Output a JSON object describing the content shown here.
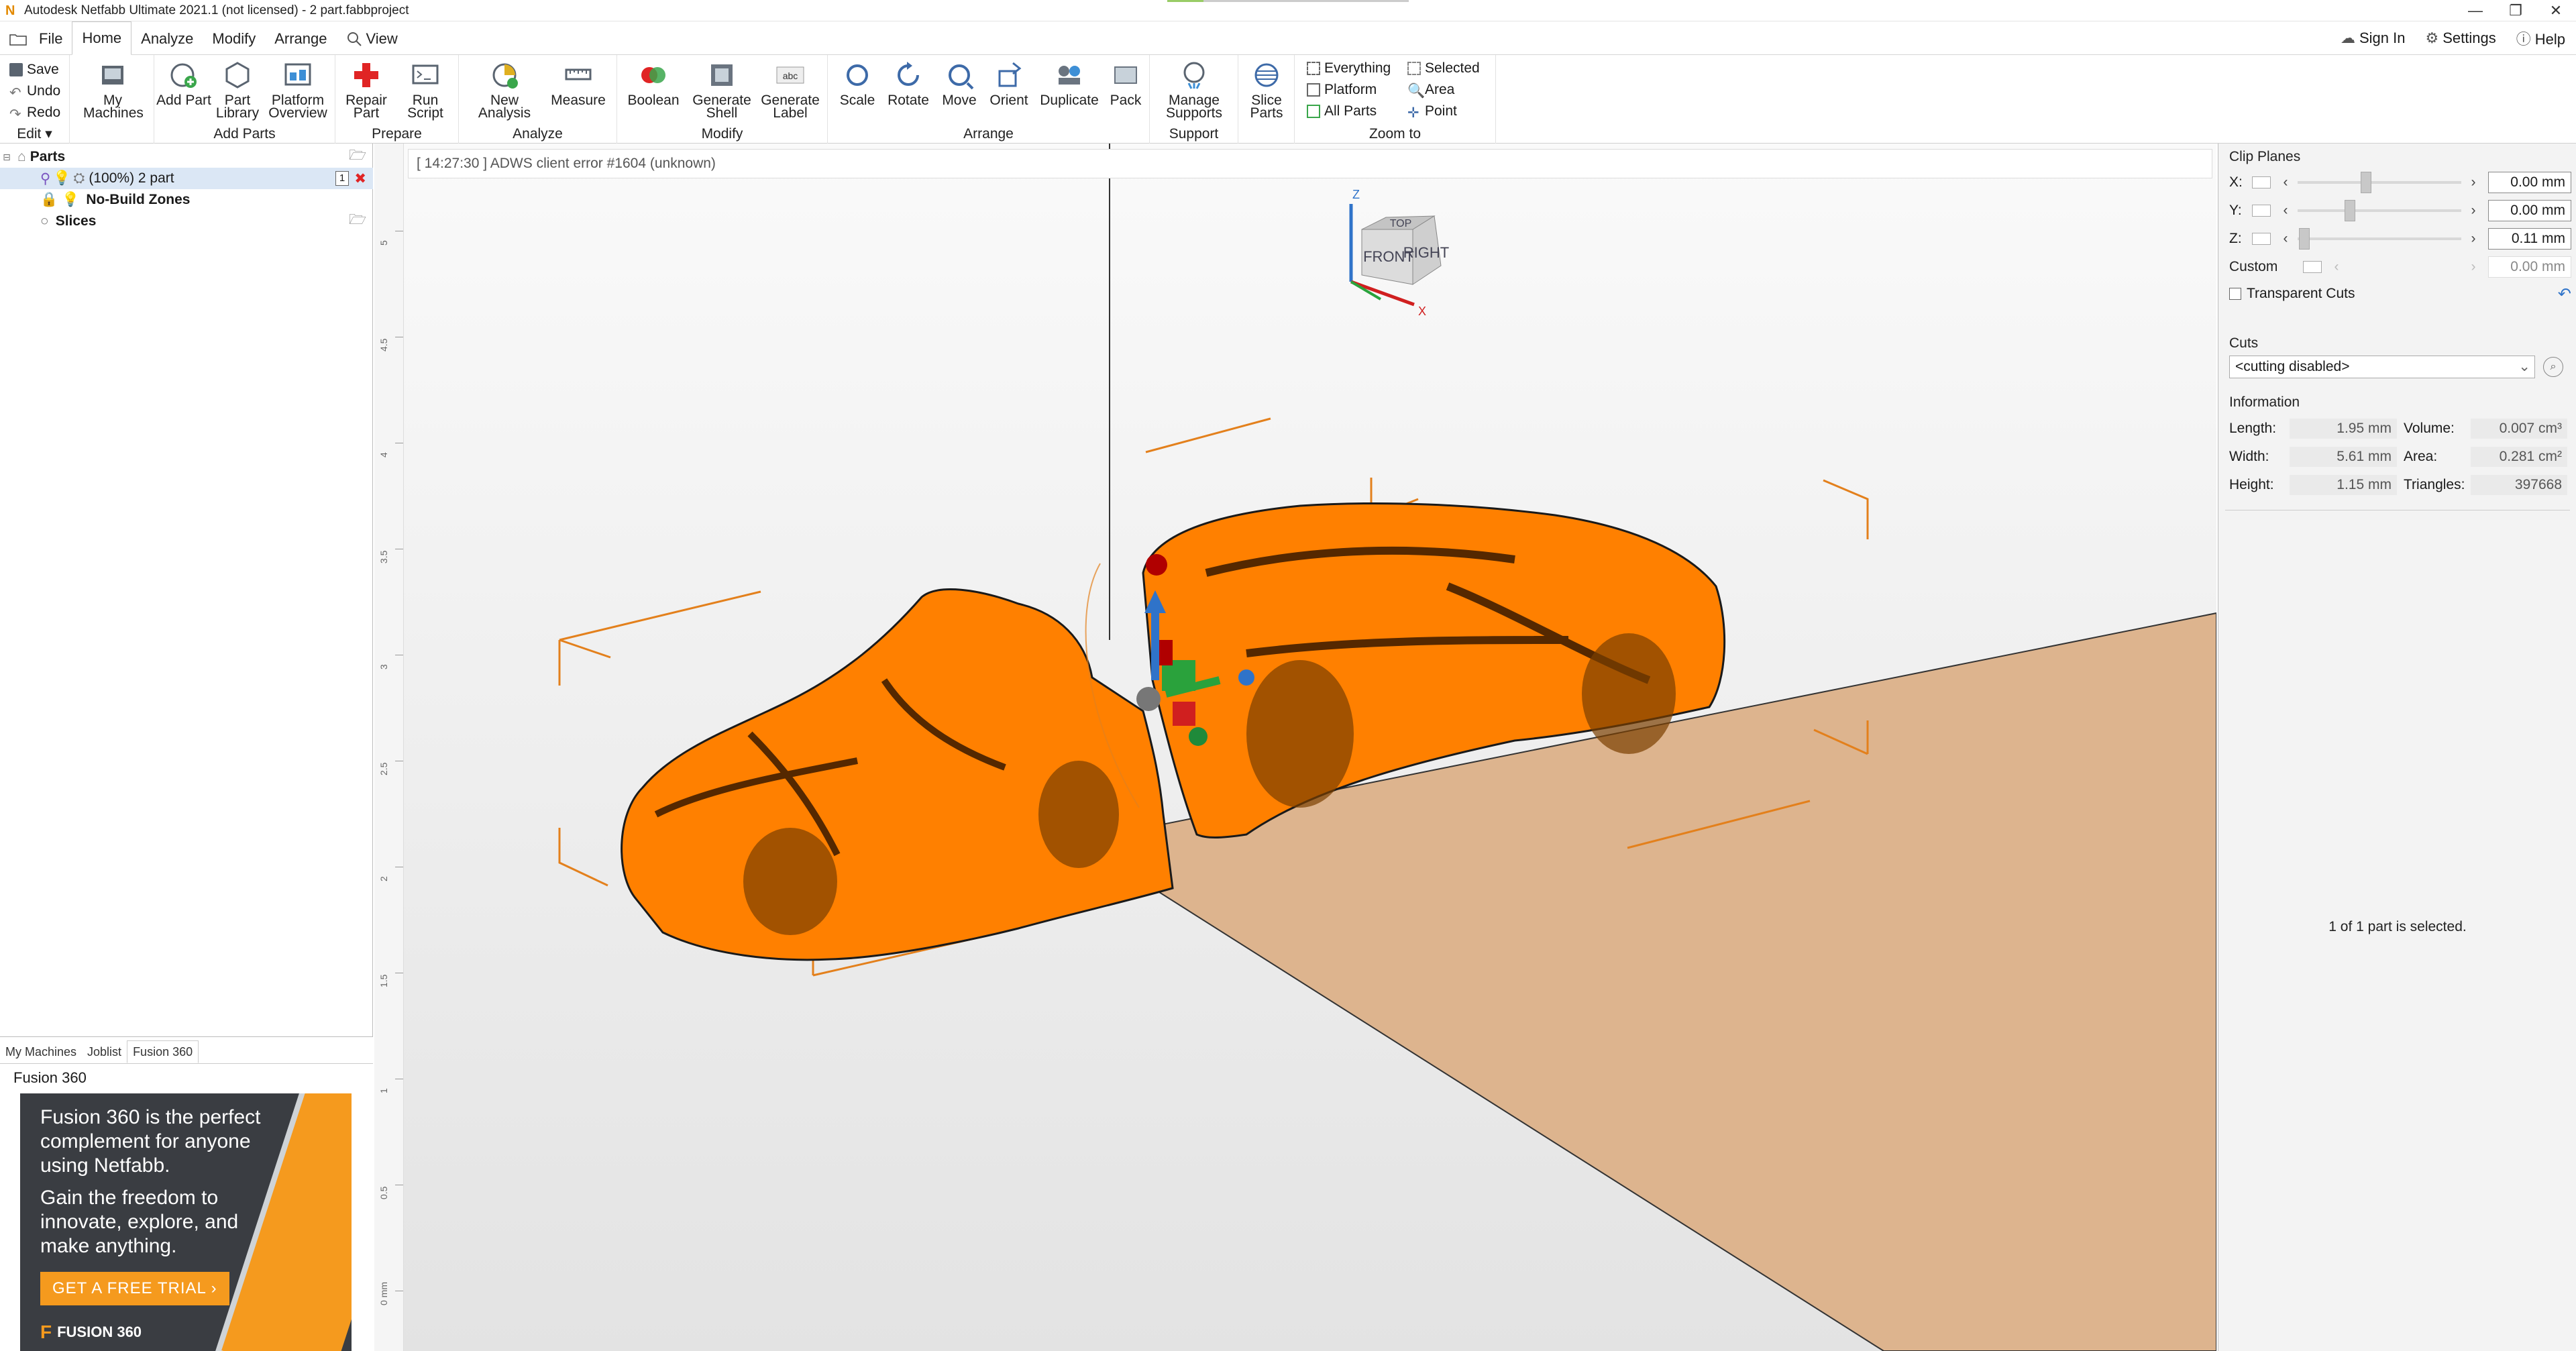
{
  "window": {
    "title": "Autodesk Netfabb Ultimate 2021.1 (not licensed) - 2 part.fabbproject",
    "progress_fraction": 0.15
  },
  "menu": {
    "items": [
      "File",
      "Home",
      "Analyze",
      "Modify",
      "Arrange",
      "View"
    ],
    "active": "Home",
    "right": {
      "sign_in": "Sign In",
      "settings": "Settings",
      "help": "Help"
    }
  },
  "ribbon": {
    "edit": {
      "save": "Save",
      "undo": "Undo",
      "redo": "Redo",
      "group": "Edit"
    },
    "my_machines": "My Machines",
    "add_parts": {
      "add_part": "Add Part",
      "part_library": "Part Library",
      "platform_overview": "Platform Overview",
      "group": "Add Parts"
    },
    "prepare": {
      "repair_part": "Repair Part",
      "run_script": "Run Script",
      "group": "Prepare"
    },
    "analyze": {
      "new_analysis": "New Analysis",
      "measure": "Measure",
      "group": "Analyze"
    },
    "modify": {
      "boolean": "Boolean",
      "generate_shell": "Generate Shell",
      "generate_label": "Generate Label",
      "group": "Modify"
    },
    "arrange": {
      "scale": "Scale",
      "rotate": "Rotate",
      "move": "Move",
      "orient": "Orient",
      "duplicate": "Duplicate",
      "pack": "Pack",
      "group": "Arrange"
    },
    "support": {
      "manage_supports": "Manage Supports",
      "group": "Support"
    },
    "slice_parts": "Slice Parts",
    "zoom": {
      "everything": "Everything",
      "platform": "Platform",
      "all_parts": "All Parts",
      "selected": "Selected",
      "area": "Area",
      "point": "Point",
      "group": "Zoom to"
    }
  },
  "tree": {
    "parts": "Parts",
    "part_item": "(100%) 2 part",
    "part_badge": "1",
    "no_build": "No-Build Zones",
    "slices": "Slices"
  },
  "left_tabs": [
    "My Machines",
    "Joblist",
    "Fusion 360"
  ],
  "left_tabs_active": "Fusion 360",
  "fusion": {
    "title": "Fusion 360",
    "line1": "Fusion 360 is the perfect complement for anyone using Netfabb.",
    "line2": "Gain the freedom to innovate, explore, and make anything.",
    "cta": "GET A FREE TRIAL ›",
    "brand": "FUSION 360"
  },
  "viewport": {
    "error": "[ 14:27:30 ] ADWS client error #1604 (unknown)",
    "ruler_ticks": [
      "5",
      "4.5",
      "4",
      "3.5",
      "3",
      "2.5",
      "2",
      "1.5",
      "1",
      "0.5",
      "0 mm"
    ],
    "cube": {
      "top": "TOP",
      "front": "FRONT",
      "right": "RIGHT",
      "z": "Z",
      "x": "X"
    },
    "part_color": "#ff8000",
    "platform_color": "#ddb48e"
  },
  "clip": {
    "title": "Clip Planes",
    "x_label": "X:",
    "x_val": "0.00 mm",
    "x_pos": 0.42,
    "y_label": "Y:",
    "y_val": "0.00 mm",
    "y_pos": 0.32,
    "z_label": "Z:",
    "z_val": "0.11 mm",
    "z_pos": 0.04,
    "custom_label": "Custom",
    "custom_val": "0.00 mm",
    "transparent": "Transparent Cuts"
  },
  "cuts": {
    "title": "Cuts",
    "value": "<cutting disabled>"
  },
  "info": {
    "title": "Information",
    "length_label": "Length:",
    "length": "1.95 mm",
    "volume_label": "Volume:",
    "volume": "0.007 cm³",
    "width_label": "Width:",
    "width": "5.61 mm",
    "area_label": "Area:",
    "area": "0.281 cm²",
    "height_label": "Height:",
    "height": "1.15 mm",
    "triangles_label": "Triangles:",
    "triangles": "397668"
  },
  "status": "1 of 1 part is selected."
}
